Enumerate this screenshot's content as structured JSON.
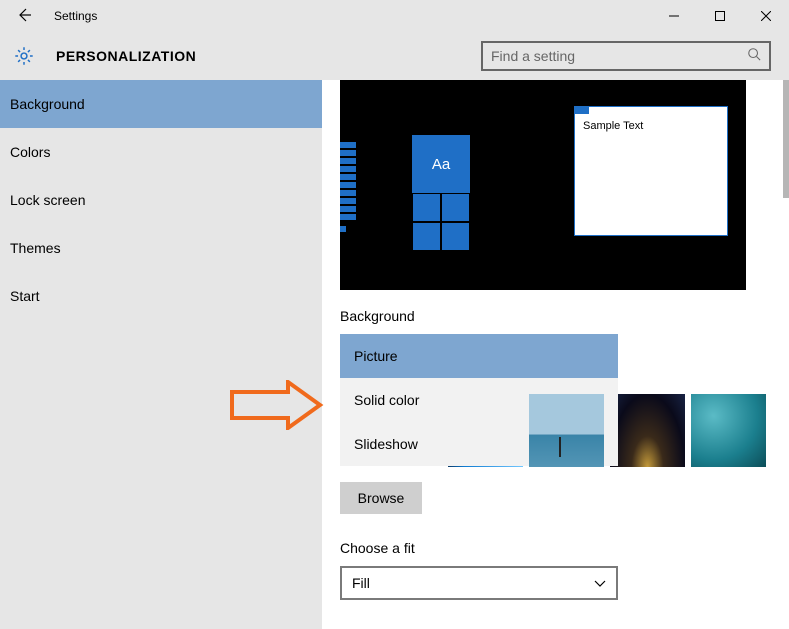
{
  "window": {
    "title": "Settings"
  },
  "page": {
    "title": "PERSONALIZATION"
  },
  "search": {
    "placeholder": "Find a setting"
  },
  "sidebar": {
    "items": [
      {
        "label": "Background",
        "active": true
      },
      {
        "label": "Colors",
        "active": false
      },
      {
        "label": "Lock screen",
        "active": false
      },
      {
        "label": "Themes",
        "active": false
      },
      {
        "label": "Start",
        "active": false
      }
    ]
  },
  "preview": {
    "tile_text": "Aa",
    "window_text": "Sample Text"
  },
  "background": {
    "label": "Background",
    "options": [
      {
        "label": "Picture",
        "selected": true
      },
      {
        "label": "Solid color",
        "selected": false
      },
      {
        "label": "Slideshow",
        "selected": false
      }
    ],
    "browse_label": "Browse"
  },
  "fit": {
    "label": "Choose a fit",
    "value": "Fill"
  },
  "colors": {
    "accent": "#1f6fc6",
    "sidebar_active": "#7ea6d0",
    "annotation": "#f06a1c"
  }
}
